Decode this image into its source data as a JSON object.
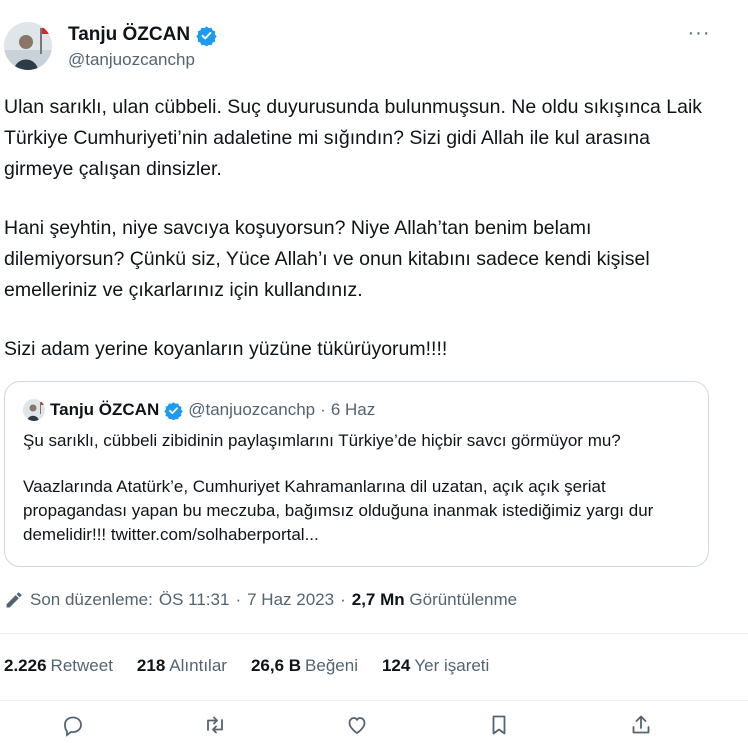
{
  "author": {
    "name": "Tanju ÖZCAN",
    "handle": "@tanjuozcanchp",
    "verified": true
  },
  "tweet": {
    "paragraphs": [
      "Ulan sarıklı, ulan cübbeli. Suç duyurusunda bulunmuşsun. Ne oldu sıkışınca Laik Türkiye Cumhuriyeti’nin adaletine mi sığındın? Sizi gidi Allah ile kul arasına girmeye çalışan dinsizler.",
      "Hani şeyhtin, niye savcıya koşuyorsun? Niye Allah’tan benim belamı dilemiyorsun? Çünkü siz, Yüce Allah’ı ve onun kitabını sadece kendi kişisel emelleriniz ve çıkarlarınız için kullandınız.",
      "Sizi adam yerine koyanların yüzüne tükürüyorum!!!!"
    ]
  },
  "quote": {
    "name": "Tanju ÖZCAN",
    "handle": "@tanjuozcanchp",
    "dot": "·",
    "date": "6 Haz",
    "paragraphs": [
      "Şu sarıklı, cübbeli zibidinin paylaşımlarını Türkiye’de hiçbir savcı görmüyor mu?",
      "Vaazlarında Atatürk’e, Cumhuriyet Kahramanlarına dil uzatan, açık açık şeriat propagandası yapan bu meczuba, bağımsız olduğuna inanmak istediğimiz yargı dur demelidir!!! twitter.com/solhaberportal..."
    ]
  },
  "meta": {
    "edited_label": "Son düzenleme:",
    "time": "ÖS 11:31",
    "sep1": "·",
    "date": "7 Haz 2023",
    "sep2": "·",
    "views_count": "2,7 Mn",
    "views_label": "Görüntülenme"
  },
  "stats": [
    {
      "num": "2.226",
      "label": "Retweet"
    },
    {
      "num": "218",
      "label": "Alıntılar"
    },
    {
      "num": "26,6 B",
      "label": "Beğeni"
    },
    {
      "num": "124",
      "label": "Yer işareti"
    }
  ],
  "more_glyph": "···",
  "icons": {
    "verified": "verified-badge-icon",
    "more": "more-options-icon",
    "edit": "pencil-icon",
    "reply": "reply-icon",
    "retweet": "retweet-icon",
    "like": "heart-icon",
    "bookmark": "bookmark-icon",
    "share": "share-icon"
  },
  "colors": {
    "verified": "#1d9bf0",
    "text": "#0f1419",
    "secondary": "#536471",
    "border": "#cfd9de"
  }
}
